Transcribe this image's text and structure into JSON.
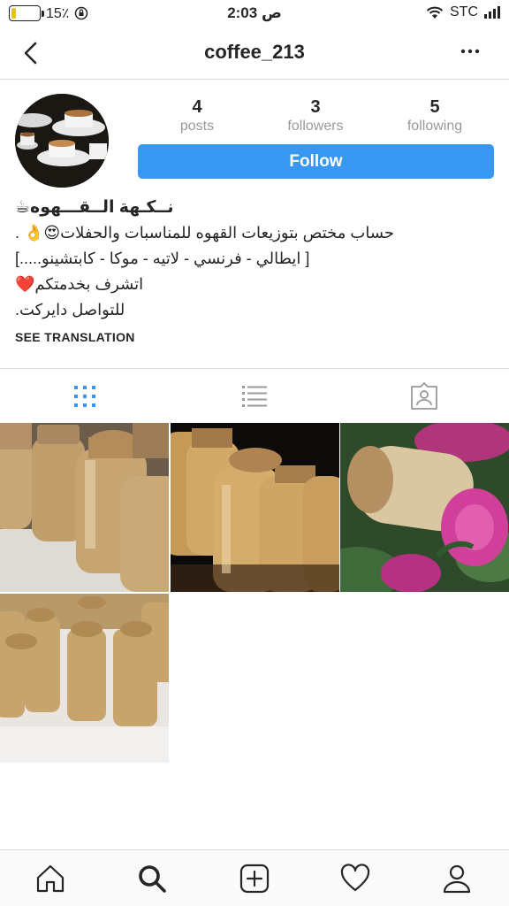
{
  "status_bar": {
    "battery": "15٪",
    "battery_level": 0.15,
    "time": "2:03 ص",
    "carrier": "STC"
  },
  "header": {
    "title": "coffee_213",
    "back_icon": "chevron-left-icon",
    "more_icon": "ellipsis-icon"
  },
  "profile": {
    "stats": [
      {
        "count": "4",
        "label": "posts"
      },
      {
        "count": "3",
        "label": "followers"
      },
      {
        "count": "5",
        "label": "following"
      }
    ],
    "follow_label": "Follow",
    "bio": {
      "name": "نــكـهة الــقـــهوه☕",
      "line1": "حساب مختص بتوزيعات القهوه للمناسبات والحفلات😍👌 .",
      "line2": "[ ايطالي - فرنسي - لاتيه - موكا - كابتشينو.....]",
      "line3": "اتشرف بخدمتكم❤️",
      "line4": "للتواصل دايركت."
    },
    "see_translation": "SEE TRANSLATION"
  },
  "view_tabs": [
    {
      "name": "grid-view",
      "icon": "grid-icon",
      "active": true
    },
    {
      "name": "list-view",
      "icon": "list-icon",
      "active": false
    },
    {
      "name": "tagged",
      "icon": "tagged-person-icon",
      "active": false
    }
  ],
  "posts": [
    {
      "subject": "coffee-bottles-closeup"
    },
    {
      "subject": "coffee-bottles-row"
    },
    {
      "subject": "coffee-bottle-with-roses"
    },
    {
      "subject": "coffee-bottles-many"
    }
  ],
  "bottom_nav": [
    {
      "name": "home",
      "icon": "home-icon"
    },
    {
      "name": "search",
      "icon": "search-icon",
      "active": true
    },
    {
      "name": "new-post",
      "icon": "plus-square-icon"
    },
    {
      "name": "activity",
      "icon": "heart-icon"
    },
    {
      "name": "profile",
      "icon": "person-icon"
    }
  ],
  "colors": {
    "accent": "#3897f0",
    "active_tab": "#3897f0",
    "muted": "#999999",
    "divider": "#dbdbdb"
  }
}
